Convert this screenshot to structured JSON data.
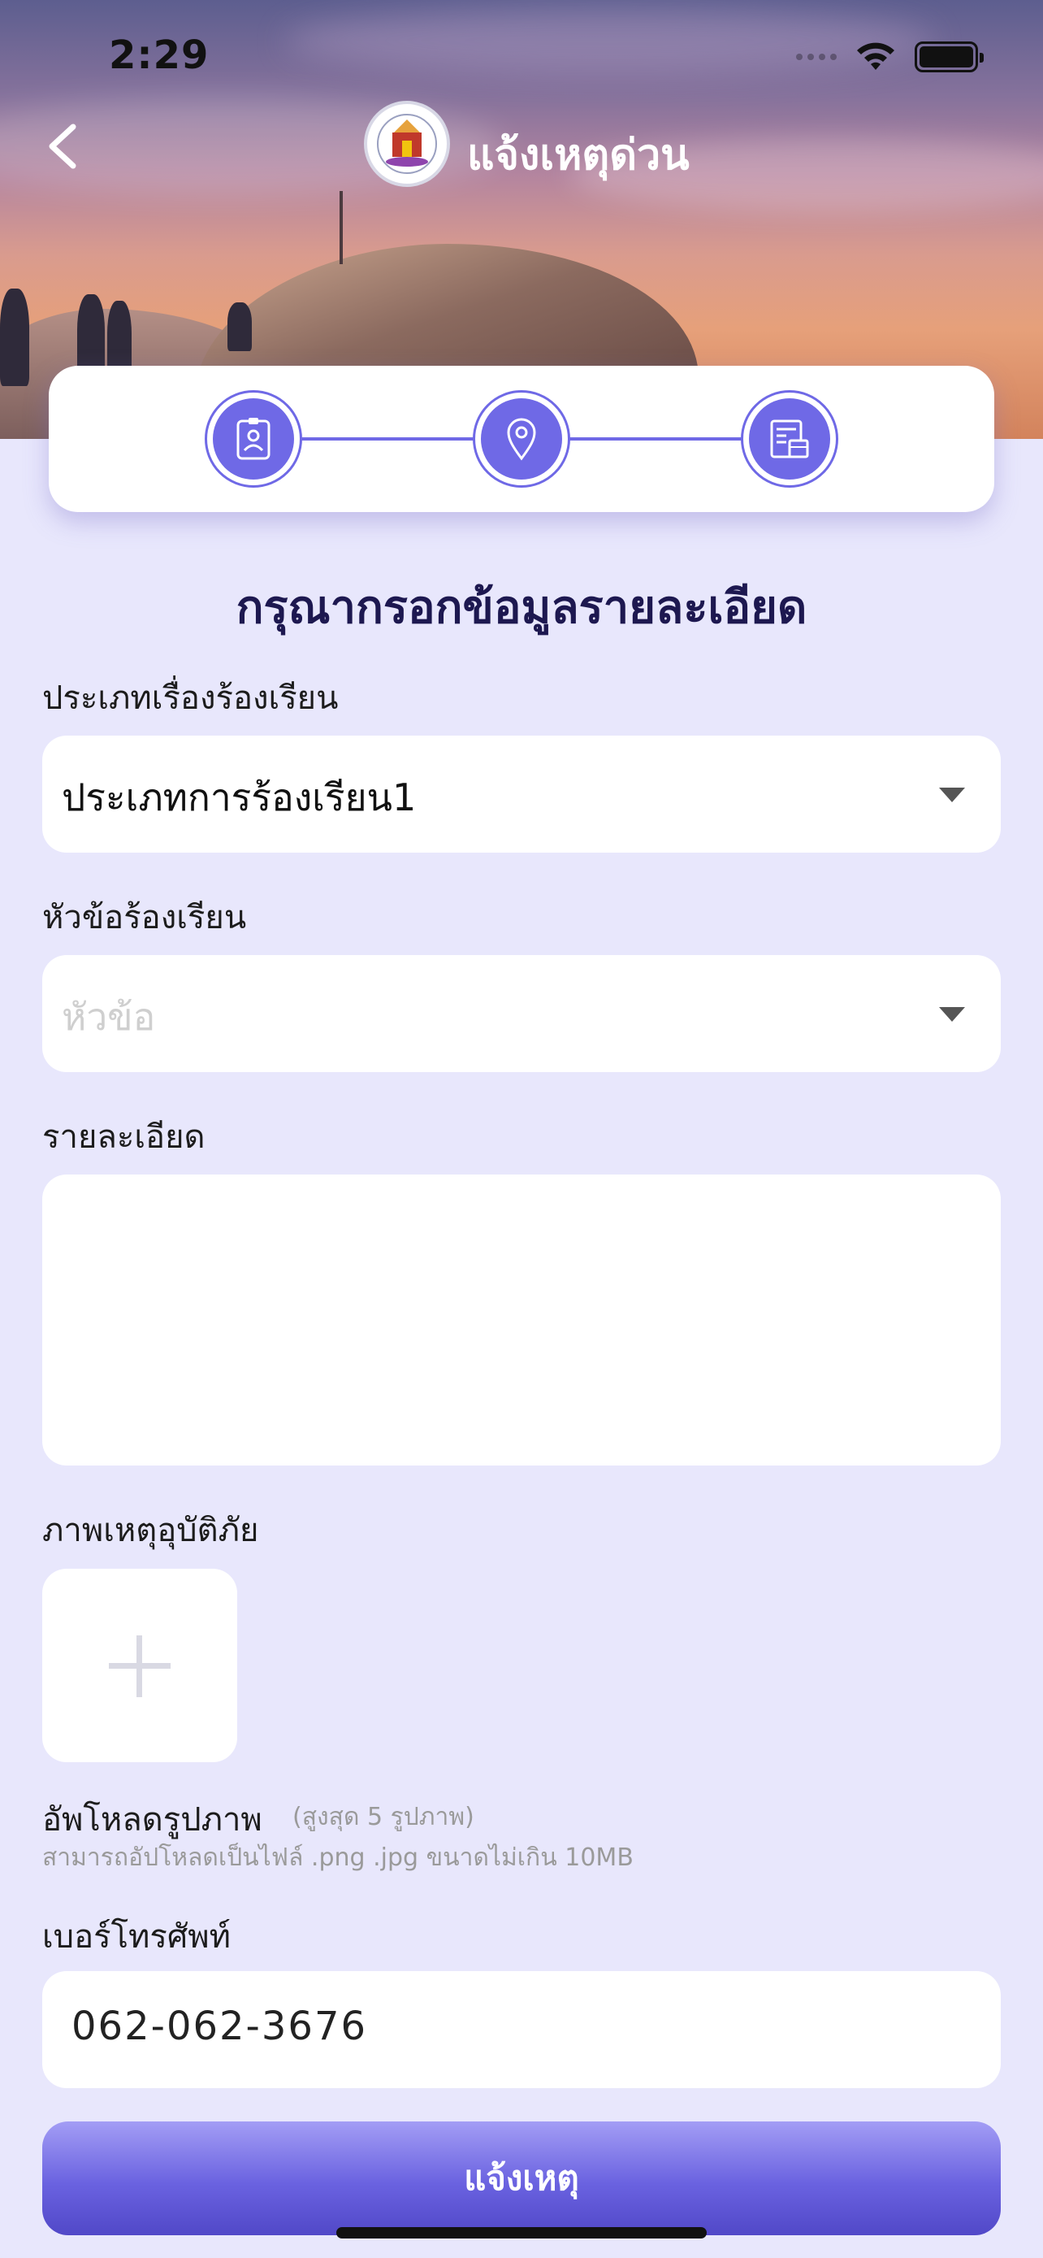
{
  "status_bar": {
    "time": "2:29"
  },
  "header": {
    "title": "แจ้งเหตุด่วน"
  },
  "stepper": {
    "steps": [
      "id-card-icon",
      "location-pin-icon",
      "document-icon"
    ],
    "accent": "#6f69e6"
  },
  "form": {
    "title": "กรุณากรอกข้อมูลรายละเอียด",
    "complaint_type": {
      "label": "ประเภทเรื่องร้องเรียน",
      "value": "ประเภทการร้องเรียน1"
    },
    "complaint_topic": {
      "label": "หัวข้อร้องเรียน",
      "placeholder": "หัวข้อ"
    },
    "details": {
      "label": "รายละเอียด",
      "value": ""
    },
    "photos": {
      "label": "ภาพเหตุอุบัติภัย",
      "upload_label": "อัพโหลดรูปภาพ",
      "limit": "(สูงสุด 5 รูปภาพ)",
      "hint": "สามารถอัปโหลดเป็นไฟล์ .png .jpg ขนาดไม่เกิน 10MB"
    },
    "phone": {
      "label": "เบอร์โทรศัพท์",
      "value": "062-062-3676"
    },
    "submit_label": "แจ้งเหตุ"
  }
}
